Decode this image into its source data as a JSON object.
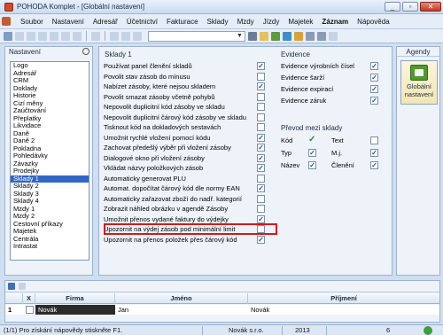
{
  "window": {
    "title": "POHODA Komplet - [Globální nastavení]",
    "buttons": [
      "_",
      "▫",
      "✕"
    ]
  },
  "menu": [
    "Soubor",
    "Nastavení",
    "Adresář",
    "Účetnictví",
    "Fakturace",
    "Sklady",
    "Mzdy",
    "Jízdy",
    "Majetek",
    "Záznam",
    "Nápověda"
  ],
  "left": {
    "title": "Nastavení",
    "items": [
      "Logo",
      "Adresář",
      "CRM",
      "Doklady",
      "Historie",
      "Cizí měny",
      "Zaúčtování",
      "Přeplatky",
      "Likvidace",
      "Daně",
      "Daně 2",
      "Pokladna",
      "Pohledávky",
      "Závazky",
      "Prodejky",
      "Sklady 1",
      "Sklady 2",
      "Sklady 3",
      "Sklady 4",
      "Mzdy 1",
      "Mzdy 2",
      "Cestovní příkazy",
      "Majetek",
      "Centrála",
      "Intrastat"
    ],
    "selected_index": 15
  },
  "sklady": {
    "title": "Sklady 1",
    "options": [
      {
        "label": "Používat panel členění skladů",
        "checked": true
      },
      {
        "label": "Povolit stav zásob do mínusu",
        "checked": false
      },
      {
        "label": "Nabízet zásoby, které nejsou skladem",
        "checked": true
      },
      {
        "label": "Povolit smazat zásoby včetně pohybů",
        "checked": false
      },
      {
        "label": "Nepovolit duplicitní kód zásoby ve skladu",
        "checked": false
      },
      {
        "label": "Nepovolit duplicitní čárový kód zásoby ve skladu",
        "checked": false
      },
      {
        "label": "Tisknout kód na dokladových sestavách",
        "checked": false
      },
      {
        "label": "Umožnit rychlé vložení pomocí kódu",
        "checked": true
      },
      {
        "label": "Zachovat předešlý výběr při vložení zásoby",
        "checked": true
      },
      {
        "label": "Dialogové okno při vložení zásoby",
        "checked": true
      },
      {
        "label": "Vkládat názvy položkových zásob",
        "checked": true
      },
      {
        "label": "Automaticky generovat PLU",
        "checked": false
      },
      {
        "label": "Automat. dopočítat čárový kód dle normy EAN",
        "checked": true
      },
      {
        "label": "Automaticky zařazovat zboží do nadř. kategorií",
        "checked": false
      },
      {
        "label": "Zobrazit náhled obrázku v agendě Zásoby",
        "checked": false
      },
      {
        "label": "Umožnit přenos vydané faktury do výdejky",
        "checked": true
      },
      {
        "label": "Upozornit na výdej zásob pod minimální limit",
        "checked": false
      },
      {
        "label": "Upozornit na přenos položek přes čárový kód",
        "checked": true
      }
    ],
    "highlight_index": 16
  },
  "evidence": {
    "title": "Evidence",
    "items": [
      {
        "label": "Evidence výrobních čísel",
        "checked": true
      },
      {
        "label": "Evidence šarží",
        "checked": true
      },
      {
        "label": "Evidence expirací",
        "checked": true
      },
      {
        "label": "Evidence záruk",
        "checked": true
      }
    ]
  },
  "prevod": {
    "title": "Převod mezi sklady",
    "rows": [
      [
        {
          "label": "Kód",
          "mark": "check"
        },
        {
          "label": "Text",
          "checked": false
        }
      ],
      [
        {
          "label": "Typ",
          "checked": true
        },
        {
          "label": "M.j.",
          "checked": true
        }
      ],
      [
        {
          "label": "Název",
          "checked": true
        },
        {
          "label": "Členění",
          "checked": true
        }
      ]
    ]
  },
  "agenda": {
    "title": "Agendy",
    "button_label_1": "Globální",
    "button_label_2": "nastavení"
  },
  "table": {
    "headers": [
      "X",
      "Firma",
      "Jméno",
      "Příjmení"
    ],
    "row": {
      "num": "1",
      "firma": "Novák",
      "jmeno": "Jan",
      "prijmeni": "Novák"
    }
  },
  "status": {
    "help": "(1/1) Pro získání nápovědy stiskněte F1.",
    "company": "Novák s.r.o.",
    "year": "2013",
    "num": "6"
  },
  "colors": {
    "selection": "#3166c5",
    "highlight_border": "#d31a1a",
    "titlebar": "#c9dcf1"
  }
}
